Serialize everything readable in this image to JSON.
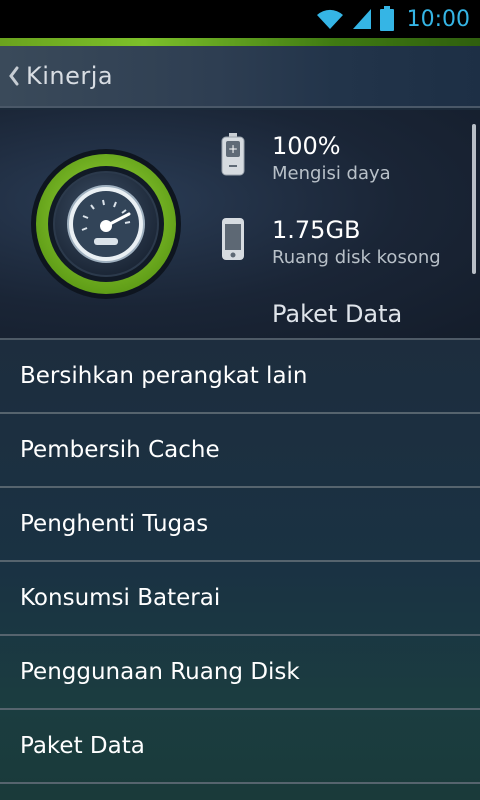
{
  "status_bar": {
    "time": "10:00"
  },
  "header": {
    "title": "Kinerja"
  },
  "summary": {
    "battery": {
      "value": "100%",
      "label": "Mengisi daya"
    },
    "disk": {
      "value": "1.75GB",
      "label": "Ruang disk kosong"
    },
    "data_plan": {
      "label": "Paket Data"
    }
  },
  "menu": [
    {
      "label": "Bersihkan perangkat lain"
    },
    {
      "label": "Pembersih Cache"
    },
    {
      "label": "Penghenti Tugas"
    },
    {
      "label": "Konsumsi Baterai"
    },
    {
      "label": "Penggunaan Ruang Disk"
    },
    {
      "label": "Paket Data"
    }
  ],
  "colors": {
    "accent_green": "#7cc02a",
    "status_blue": "#35b5e5"
  },
  "icons": [
    "wifi-icon",
    "signal-icon",
    "battery-status-icon",
    "back-icon",
    "speedometer-icon",
    "battery-icon",
    "phone-icon"
  ]
}
